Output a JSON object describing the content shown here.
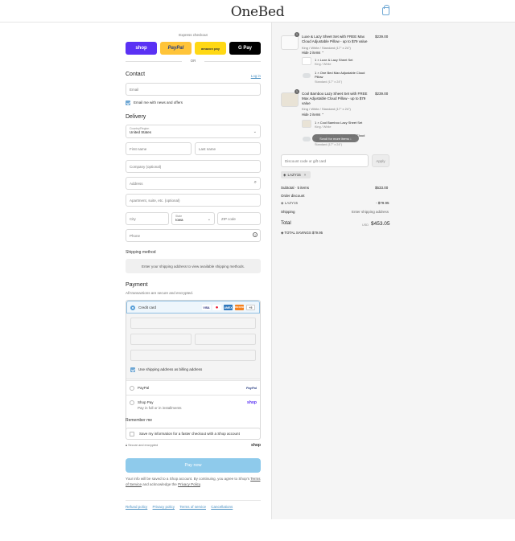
{
  "header": {
    "logo": "OneBed",
    "cart_icon": "shopping-bag-icon"
  },
  "express": {
    "label": "Express checkout",
    "buttons": [
      {
        "label": "shop",
        "color": "#5a31f4"
      },
      {
        "label": "PayPal",
        "color": "#ffc439"
      },
      {
        "label": "amazon pay",
        "color": "#ffd814"
      },
      {
        "label": "G Pay",
        "color": "#000000"
      }
    ],
    "or": "OR"
  },
  "contact": {
    "heading": "Contact",
    "login": "Log in",
    "email_placeholder": "Email",
    "newsletter": "Email me with news and offers"
  },
  "delivery": {
    "heading": "Delivery",
    "country_label": "Country/Region",
    "country_value": "United States",
    "first_name": "First name",
    "last_name": "Last name",
    "company": "Company (optional)",
    "address": "Address",
    "apartment": "Apartment, suite, etc. (optional)",
    "city": "City",
    "state_label": "State",
    "state_value": "Iowa",
    "zip": "ZIP code",
    "phone": "Phone"
  },
  "shipping_method": {
    "heading": "Shipping method",
    "info": "Enter your shipping address to view available shipping methods."
  },
  "payment": {
    "heading": "Payment",
    "subtitle": "All transactions are secure and encrypted.",
    "credit_card": "Credit card",
    "card_brands": [
      "VISA",
      "MC",
      "AMEX",
      "DISCOVER"
    ],
    "more_label": "+5",
    "billing_same": "Use shipping address as billing address",
    "paypal": "PayPal",
    "paypal_logo": "PayPal",
    "shop_pay": "Shop Pay",
    "shop_pay_sub": "Pay in full or in installments",
    "shop_logo": "shop"
  },
  "remember": {
    "heading": "Remember me",
    "save_info": "Save my information for a faster checkout with a Shop account",
    "secure": "Secure and encrypted",
    "shop_logo": "shop"
  },
  "pay_now": "Pay now",
  "legal": {
    "text1": "Your info will be saved to a Shop account. By continuing, you agree to Shop's ",
    "terms": "Terms of Service",
    "text2": " and acknowledge the ",
    "privacy": "Privacy Policy",
    "text3": "."
  },
  "footer": {
    "links": [
      "Refund policy",
      "Privacy policy",
      "Terms of service",
      "Cancellations"
    ]
  },
  "order": {
    "items": [
      {
        "qty": "1",
        "title": "Luxe & Lazy Sheet Set with FREE Max Cloud Adjustable Pillow - up to $79 value",
        "variant": "King / White / Standard (17\" x 24\")",
        "price": "$239.00",
        "hide": "Hide 2 items",
        "sub": [
          {
            "title": "1 × Luxe & Lazy Sheet Set",
            "variant": "King / White"
          },
          {
            "title": "1 × One Bed Max Adjustable Cloud Pillow",
            "variant": "Standard (17\" x 24\")"
          }
        ]
      },
      {
        "qty": "1",
        "title": "Cool Bamboo Lazy Sheet Set with FREE Max Adjustable Cloud Pillow - up to $79 value",
        "variant": "King / White / Standard (17\" x 24\")",
        "price": "$239.00",
        "hide": "Hide 2 items",
        "sub": [
          {
            "title": "1 × Cool Bamboo Lazy Sheet Set",
            "variant": "King / White"
          },
          {
            "title": "1 × One Bed Max Adjustable Cloud Pillow",
            "variant": "Standard (17\" x 24\")"
          }
        ]
      }
    ],
    "scroll_tip": "Scroll for more items",
    "discount_placeholder": "Discount code or gift card",
    "apply": "Apply",
    "code_chip": "LAZY15",
    "subtotal_label": "Subtotal · 5 items",
    "subtotal": "$533.00",
    "order_discount_label": "Order discount",
    "discount_code": "LAZY15",
    "discount_value": "- $79.95",
    "shipping_label": "Shipping",
    "shipping_value": "Enter shipping address",
    "total_label": "Total",
    "currency": "USD",
    "total": "$453.05",
    "savings_label": "TOTAL SAVINGS",
    "savings": "$79.95"
  }
}
